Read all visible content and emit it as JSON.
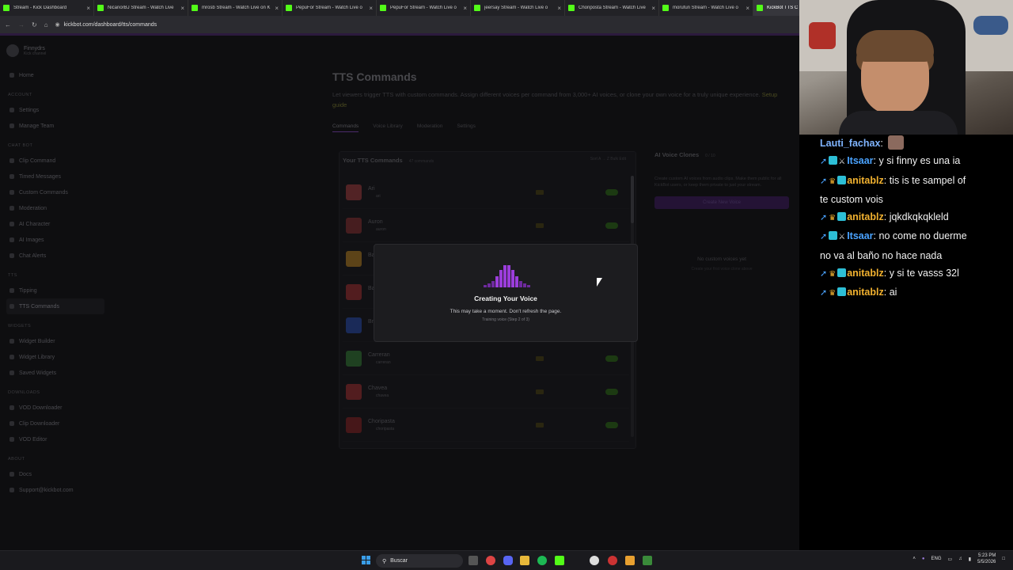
{
  "browser": {
    "tabs": [
      {
        "title": "Stream - Kick Dashboard",
        "active": false
      },
      {
        "title": "NicanorBJ Stream - Watch Live",
        "active": false
      },
      {
        "title": "mrosb Stream - Watch Live on K",
        "active": false
      },
      {
        "title": "PepuFor Stream - Watch Live o",
        "active": false
      },
      {
        "title": "PepuFor Stream - Watch Live o",
        "active": false
      },
      {
        "title": "jeersay Stream - Watch Live o",
        "active": false
      },
      {
        "title": "Choriposta Stream - Watch Live",
        "active": false
      },
      {
        "title": "morufun Stream - Watch Live o",
        "active": false
      },
      {
        "title": "KickBot TTS C",
        "active": true
      }
    ],
    "url": "kickbot.com/dashboard/tts/commands"
  },
  "sidebar": {
    "username": "Finnydrs",
    "user_sub": "Kick channel",
    "home": "Home",
    "sections": [
      {
        "title": "ACCOUNT",
        "items": [
          "Settings",
          "Manage Team"
        ]
      },
      {
        "title": "CHAT BOT",
        "items": [
          "Clip Command",
          "Timed Messages",
          "Custom Commands",
          "Moderation",
          "AI Character",
          "AI Images",
          "Chat Alerts"
        ]
      },
      {
        "title": "TTS",
        "items": [
          "Tipping",
          "TTS Commands"
        ]
      },
      {
        "title": "WIDGETS",
        "items": [
          "Widget Builder",
          "Widget Library",
          "Saved Widgets"
        ]
      },
      {
        "title": "DOWNLOADS",
        "items": [
          "VOD Downloader",
          "Clip Downloader",
          "VOD Editor"
        ]
      },
      {
        "title": "ABOUT",
        "items": [
          "Docs",
          "Support@kickbot.com"
        ]
      }
    ]
  },
  "page": {
    "title": "TTS Commands",
    "description": "Let viewers trigger TTS with custom commands. Assign different voices per command from 3,000+ AI voices, or clone your own voice for a truly unique experience.",
    "setup_link": "Setup guide",
    "tabs": [
      "Commands",
      "Voice Library",
      "Moderation",
      "Settings"
    ],
    "panel_title": "Your TTS Commands",
    "panel_count": "47 commands",
    "panel_actions": "Sort A → Z      Bulk Edit",
    "commands": [
      {
        "name": "Ari",
        "cmd": "ari"
      },
      {
        "name": "Auron",
        "cmd": "auron"
      },
      {
        "name": "Bad",
        "cmd": "bad"
      },
      {
        "name": "Bar",
        "cmd": "bar"
      },
      {
        "name": "Bro",
        "cmd": "bro"
      },
      {
        "name": "Carreran",
        "cmd": "carreran"
      },
      {
        "name": "Chavea",
        "cmd": "chavea"
      },
      {
        "name": "Choripasta",
        "cmd": "choripasta"
      }
    ],
    "clones_title": "AI Voice Clones",
    "clones_count": "0 / 10",
    "clones_desc": "Create custom AI voices from audio clips. Make them public for all KickBot users, or keep them private to just your stream.",
    "clones_button": "Create New Voice",
    "clones_empty": "No custom voices yet",
    "clones_empty_sub": "Create your first voice clone above"
  },
  "modal": {
    "title": "Creating Your Voice",
    "text": "This may take a moment. Don't refresh the page.",
    "step": "Training voice (Step 2 of 3)"
  },
  "chat": {
    "messages": [
      {
        "user": "Lauti_fachax",
        "color": "#7fb4ff",
        "badges": [],
        "text": "",
        "emote": true
      },
      {
        "user": "Itsaar",
        "color": "#4aa3ff",
        "badges": [
          "pin",
          "bot",
          "sword"
        ],
        "text": "y si finny es una ia"
      },
      {
        "user": "anitablz",
        "color": "#f2b230",
        "badges": [
          "pin",
          "crown",
          "bot"
        ],
        "text": "tis is te sampel of"
      },
      {
        "user": "",
        "color": "#ffffff",
        "badges": [],
        "text": "te custom vois"
      },
      {
        "user": "anitablz",
        "color": "#f2b230",
        "badges": [
          "pin",
          "crown",
          "bot"
        ],
        "text": "jqkdkqkqkleld"
      },
      {
        "user": "Itsaar",
        "color": "#4aa3ff",
        "badges": [
          "pin",
          "bot",
          "sword"
        ],
        "text": "no come no duerme"
      },
      {
        "user": "",
        "color": "#ffffff",
        "badges": [],
        "text": "no va al baño no hace nada"
      },
      {
        "user": "anitablz",
        "color": "#f2b230",
        "badges": [
          "pin",
          "crown",
          "bot"
        ],
        "text": "y si te vasss 32l"
      },
      {
        "user": "anitablz",
        "color": "#f2b230",
        "badges": [
          "pin",
          "crown",
          "bot"
        ],
        "text": "ai"
      }
    ]
  },
  "taskbar": {
    "search": "Buscar",
    "lang": "ENG",
    "time": "5:23 PM",
    "date": "5/5/2026"
  }
}
